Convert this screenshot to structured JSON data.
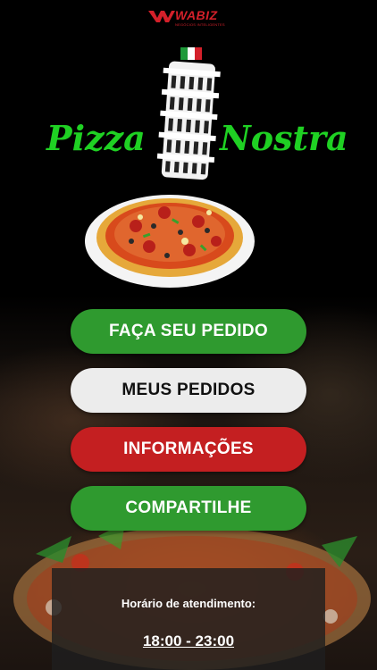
{
  "brand": {
    "name": "WABIZ",
    "tagline": "NEGÓCIOS INTELIGENTES",
    "color": "#d4202a"
  },
  "logo": {
    "word_left": "Pizza",
    "word_right": "Nostra",
    "text_color": "#1fd123",
    "flag_colors": [
      "#1f9a3a",
      "#ffffff",
      "#d4202a"
    ]
  },
  "menu": {
    "order_label": "FAÇA SEU PEDIDO",
    "my_orders_label": "MEUS PEDIDOS",
    "info_label": "INFORMAÇÕES",
    "share_label": "COMPARTILHE",
    "colors": {
      "green": "#2f9a2f",
      "light": "#ececec",
      "red": "#c41f21"
    }
  },
  "hours": {
    "label": "Horário de atendimento:",
    "value": "18:00 - 23:00"
  }
}
